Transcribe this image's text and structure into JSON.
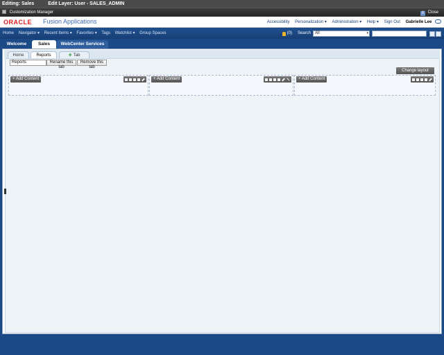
{
  "edit_bar": {
    "editing": "Editing: Sales",
    "layer": "Edit Layer: User - SALES_ADMIN"
  },
  "cm_bar": {
    "title": "Customization Manager",
    "close_label": "Close",
    "close_glyph": "X"
  },
  "header": {
    "logo": "ORACLE",
    "app_title": "Fusion Applications",
    "links": [
      "Accessibility",
      "Personalization ▾",
      "Administration ▾",
      "Help ▾",
      "Sign Out"
    ],
    "user": "Gabrielle Lee"
  },
  "nav": {
    "items": [
      "Home",
      "Navigator ▾",
      "Recent Items ▾",
      "Favorites ▾",
      "Tags",
      "Watchlist ▾",
      "Group Spaces"
    ],
    "notifications_count": "(0)",
    "search_label": "Search",
    "search_scope": "All",
    "search_dropdown_glyph": "▾"
  },
  "page_tabs": [
    "Welcome",
    "Sales",
    "WebCenter Services"
  ],
  "sub_tabs": {
    "home": "Home",
    "reports": "Reports",
    "add": "Tab",
    "plus_glyph": "+"
  },
  "tab_editor": {
    "name_value": "Reports",
    "rename": "Rename this tab",
    "remove": "Remove this tab"
  },
  "change_layout": "Change layout",
  "add_content": "+ Add Content",
  "colors": {
    "nav_bg": "#1f4f8f",
    "logo_red": "#e21b1b",
    "workspace_bg": "#eef3f8"
  }
}
